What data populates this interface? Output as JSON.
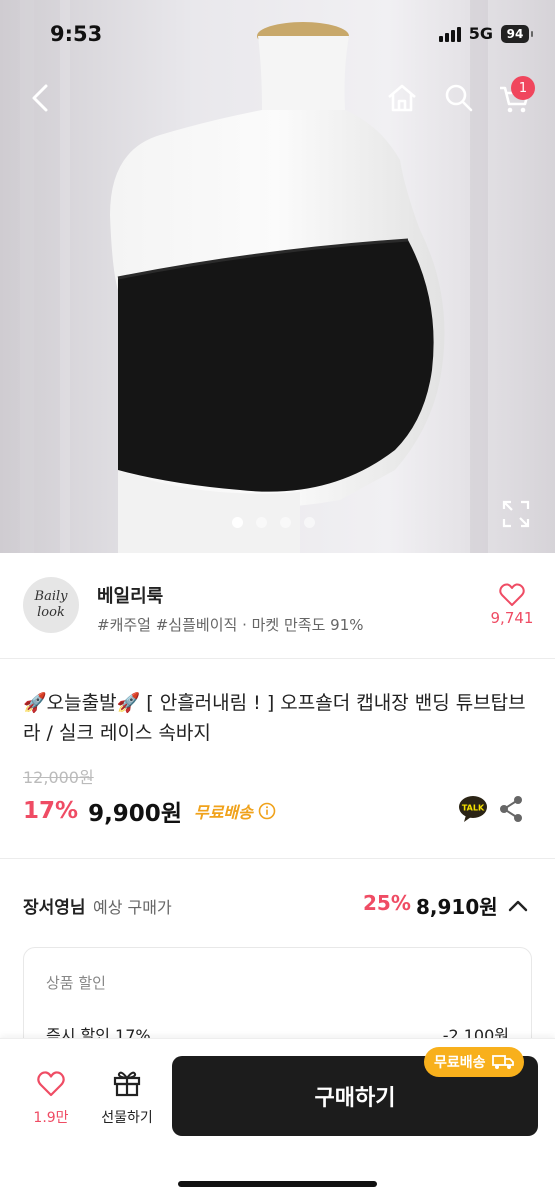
{
  "status": {
    "time": "9:53",
    "network": "5G",
    "battery": "94"
  },
  "hero": {
    "cart_count": "1",
    "slide_count": 4,
    "active_slide": 0
  },
  "seller": {
    "logo_line1": "Baily",
    "logo_line2": "look",
    "name": "베일리룩",
    "tags": "#캐주얼 #심플베이직 · 마켓 만족도 91%",
    "like_count": "9,741"
  },
  "product": {
    "title": "🚀오늘출발🚀 [ 안흘러내림 ! ] 오프숄더 캡내장 밴딩 튜브탑브라 / 실크 레이스 속바지",
    "original_price": "12,000원",
    "discount_rate": "17%",
    "sale_price": "9,900원",
    "shipping": "무료배송",
    "talk_label": "TALK"
  },
  "expected": {
    "user": "장서영님",
    "label": "예상 구매가",
    "rate": "25%",
    "price": "8,910원"
  },
  "discount_box": {
    "title": "상품 할인",
    "row_label": "즉시 할인 17%",
    "row_value": "-2,100원"
  },
  "bottom": {
    "wish_count": "1.9만",
    "gift_label": "선물하기",
    "buy_label": "구매하기",
    "badge_label": "무료배송"
  },
  "colors": {
    "accent": "#ef4c64",
    "shipping": "#f0a21b",
    "badge": "#f8b01c"
  }
}
